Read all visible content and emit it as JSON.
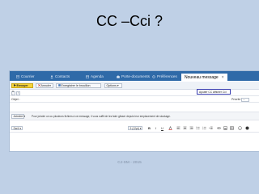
{
  "slide": {
    "title": "CC –Cci ?",
    "footer": "CJ-SM - 2015"
  },
  "app": {
    "tabs": [
      {
        "label": "Courrier",
        "icon": "mail-icon"
      },
      {
        "label": "Contacts",
        "icon": "contacts-icon"
      },
      {
        "label": "Agenda",
        "icon": "calendar-icon"
      },
      {
        "label": "Porte-documents",
        "icon": "briefcase-icon"
      },
      {
        "label": "Préférences",
        "icon": "preferences-icon"
      }
    ],
    "active_tab": "Nouveau message",
    "active_tab_close": "×",
    "toolbar": {
      "send": "Envoyer",
      "cancel": "Annuler",
      "save_draft": "Enregistrer le brouillon",
      "options": "Options ▾"
    },
    "to_row": {
      "btn1": "À :",
      "btn2": "!",
      "cc_toggle": "Ajouter CC   Afficher Cci"
    },
    "subject_row": {
      "label": "Objet :",
      "priority": "Priorité :",
      "priority_value": "–"
    },
    "attach_row": {
      "button": "Joindre ▾",
      "hint": "Pour joindre un ou plusieurs fichiers à ce message, il vous suffit de les faire glisser depuis leur emplacement de stockage."
    },
    "format_row": {
      "font": "Serif ▾",
      "size": "9 (12pt) ▾",
      "bold": "B",
      "italic": "I",
      "underline": "U"
    }
  },
  "colors": {
    "tabbar": "#2f6aa8",
    "send": "#f5d33a",
    "highlight": "#3a3eb0"
  }
}
